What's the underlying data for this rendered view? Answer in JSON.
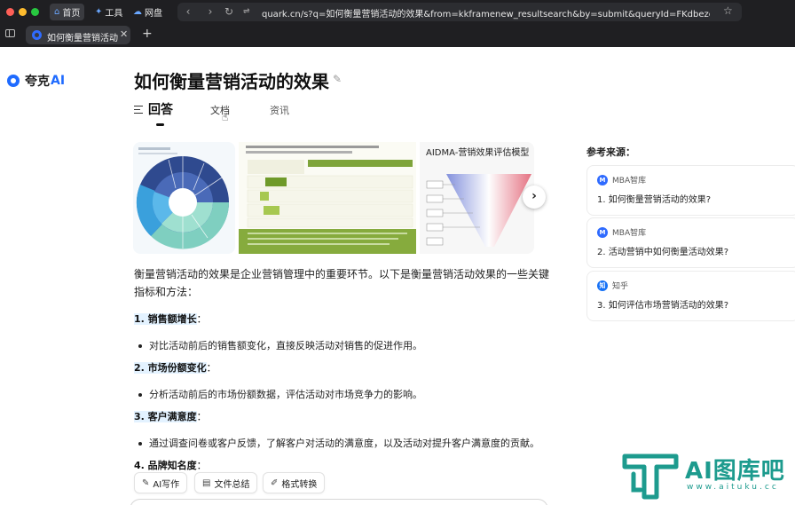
{
  "browser": {
    "top_nav": [
      {
        "label": "首页",
        "icon": "home-icon"
      },
      {
        "label": "工具",
        "icon": "sparkle-icon"
      },
      {
        "label": "网盘",
        "icon": "cloud-icon"
      }
    ],
    "url": "quark.cn/s?q=如何衡量营销活动的效果&from=kkframenew_resultsearch&by=submit&queryId=FKdbezcjnjsC%...",
    "tab_title": "如何衡量营销活动的效",
    "colors": {
      "chrome": "#1f1f22",
      "accent": "#1f6bff"
    }
  },
  "logo": {
    "text": "夸克",
    "ai": "AI"
  },
  "page": {
    "title": "如何衡量营销活动的效果",
    "tabs": [
      "回答",
      "文档",
      "资讯"
    ],
    "active_tab": "回答"
  },
  "carousel": {
    "image3_title": "AIDMA-营销效果评估模型"
  },
  "answer": {
    "intro": "衡量营销活动的效果是企业营销管理中的重要环节。以下是衡量营销活动效果的一些关键指标和方法：",
    "items": [
      {
        "heading": "1. 销售额增长",
        "bullet": "对比活动前后的销售额变化，直接反映活动对销售的促进作用。"
      },
      {
        "heading": "2. 市场份额变化",
        "bullet": "分析活动前后的市场份额数据，评估活动对市场竞争力的影响。"
      },
      {
        "heading": "3. 客户满意度",
        "bullet": "通过调查问卷或客户反馈，了解客户对活动的满意度，以及活动对提升客户满意度的贡献。"
      },
      {
        "heading": "4. 品牌知名度",
        "bullet": ""
      }
    ]
  },
  "tools": [
    "AI写作",
    "文件总结",
    "格式转换"
  ],
  "references": {
    "title": "参考来源：",
    "items": [
      {
        "source": "MBA智库",
        "text": "1. 如何衡量营销活动的效果?",
        "badge_color": "#2f6bff"
      },
      {
        "source": "MBA智库",
        "text": "2. 活动营销中如何衡量活动效果?",
        "badge_color": "#2f6bff"
      },
      {
        "source": "知乎",
        "text": "3. 如何评估市场营销活动的效果?",
        "badge_color": "#1772f6"
      }
    ]
  },
  "watermark": {
    "text": "AI图库吧",
    "url": "www.aituku.cc",
    "color": "#1d9b8e"
  }
}
